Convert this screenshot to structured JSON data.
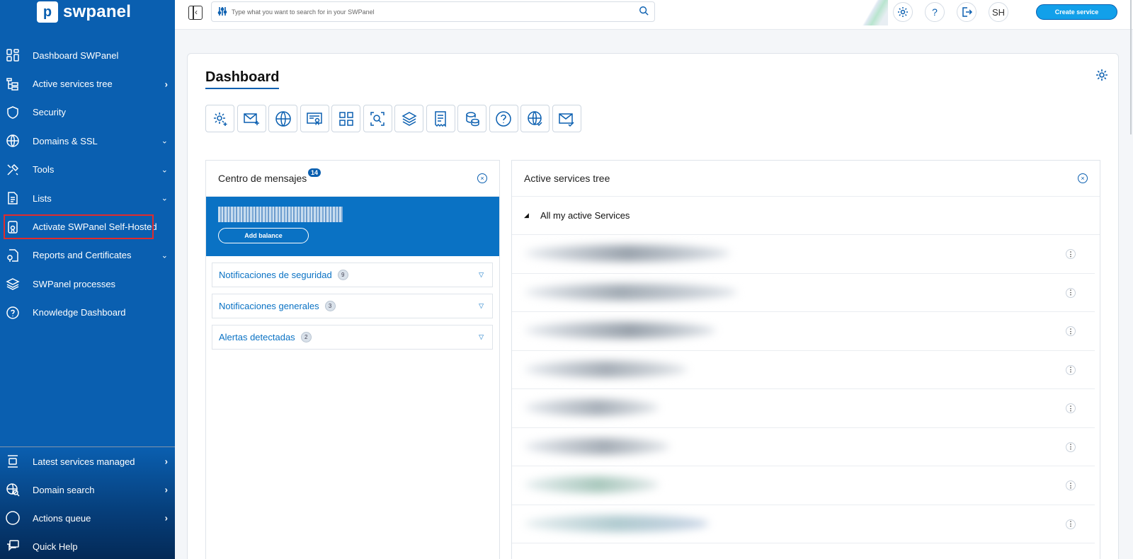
{
  "brand": {
    "name": "swpanel",
    "logo_glyph": "p"
  },
  "sidebar": {
    "items": [
      {
        "label": "Dashboard SWPanel",
        "icon": "dashboard-grid-icon",
        "chevron": ""
      },
      {
        "label": "Active services tree",
        "icon": "tree-icon",
        "chevron": "›"
      },
      {
        "label": "Security",
        "icon": "shield-icon",
        "chevron": ""
      },
      {
        "label": "Domains & SSL",
        "icon": "www-globe-icon",
        "chevron": "⌄"
      },
      {
        "label": "Tools",
        "icon": "tools-icon",
        "chevron": "⌄"
      },
      {
        "label": "Lists",
        "icon": "list-document-icon",
        "chevron": "⌄"
      },
      {
        "label": "Activate SWPanel Self-Hosted",
        "icon": "certificate-icon",
        "chevron": ""
      },
      {
        "label": "Reports and Certificates",
        "icon": "report-icon",
        "chevron": "⌄"
      },
      {
        "label": "SWPanel processes",
        "icon": "layers-icon",
        "chevron": ""
      },
      {
        "label": "Knowledge Dashboard",
        "icon": "help-circle-icon",
        "chevron": ""
      }
    ],
    "bottom_items": [
      {
        "label": "Latest services managed",
        "icon": "services-managed-icon",
        "chevron": "›"
      },
      {
        "label": "Domain search",
        "icon": "domain-search-icon",
        "chevron": "›"
      },
      {
        "label": "Actions queue",
        "icon": "queue-circle-icon",
        "chevron": "›"
      },
      {
        "label": "Quick Help",
        "icon": "chat-help-icon",
        "chevron": ""
      }
    ]
  },
  "topbar": {
    "search_placeholder": "Type what you want to search for in your SWPanel",
    "avatar_initials": "SH",
    "create_label": "Create service"
  },
  "dashboard": {
    "title": "Dashboard",
    "shortcuts": [
      "gear-add-icon",
      "mail-add-icon",
      "www-icon",
      "certificate-icon",
      "grid-icon",
      "search-scan-icon",
      "layers-icon",
      "receipt-icon",
      "database-icon",
      "help-icon",
      "globe-check-icon",
      "mail-check-icon"
    ]
  },
  "messages": {
    "title": "Centro de mensajes",
    "badge": "14",
    "add_balance": "Add balance",
    "sections": [
      {
        "label": "Notificaciones de seguridad",
        "count": "9"
      },
      {
        "label": "Notificaciones generales",
        "count": "3"
      },
      {
        "label": "Alertas detectadas",
        "count": "2"
      }
    ]
  },
  "tree": {
    "title": "Active services tree",
    "root_label": "All my active Services"
  },
  "colors": {
    "sidebar": "#0a5fb0",
    "accent": "#0a72c4",
    "create_button": "#12a0ea",
    "highlight": "#e32b2b"
  }
}
